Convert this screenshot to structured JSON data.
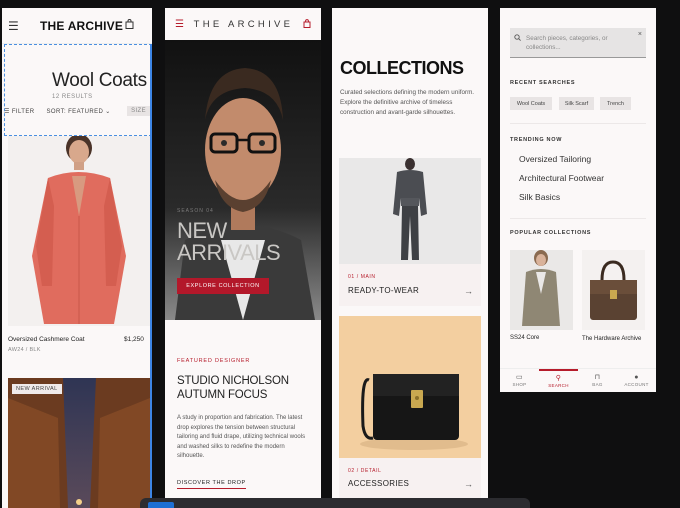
{
  "screen1": {
    "brand": "THE ARCHIVE",
    "title": "Wool Coats",
    "results": "12 RESULTS",
    "filter_label": "FILTER",
    "sort_label": "SORT: FEATURED",
    "size_label": "SIZE",
    "product": {
      "name": "Oversized Cashmere Coat",
      "meta": "AW24 / BLK",
      "price": "$1,250"
    },
    "badge": "NEW ARRIVAL"
  },
  "screen2": {
    "brand": "THE ARCHIVE",
    "season": "SEASON 04",
    "hero_title_1": "NEW",
    "hero_title_2": "ARRIVALS",
    "cta": "EXPLORE COLLECTION",
    "featured_label": "FEATURED DESIGNER",
    "designer_1": "STUDIO NICHOLSON",
    "designer_2": "AUTUMN FOCUS",
    "description": "A study in proportion and fabrication. The latest drop explores the tension between structural tailoring and fluid drape, utilizing technical wools and washed silks to redefine the modern silhouette.",
    "link": "DISCOVER THE DROP"
  },
  "screen3": {
    "title": "COLLECTIONS",
    "description": "Curated selections defining the modern uniform. Explore the definitive archive of timeless construction and avant-garde silhouettes.",
    "cards": [
      {
        "num": "01 / MAIN",
        "name": "READY-TO-WEAR"
      },
      {
        "num": "02 / DETAIL",
        "name": "ACCESSORIES"
      }
    ]
  },
  "screen4": {
    "search_placeholder": "Search pieces, categories, or collections...",
    "recent_heading": "RECENT SEARCHES",
    "recent": [
      "Wool Coats",
      "Silk Scarf",
      "Trench"
    ],
    "trending_heading": "TRENDING NOW",
    "trending": [
      "Oversized Tailoring",
      "Architectural Footwear",
      "Silk Basics"
    ],
    "popular_heading": "POPULAR COLLECTIONS",
    "popular": [
      "SS24 Core",
      "The Hardware Archive"
    ],
    "nav": [
      "SHOP",
      "SEARCH",
      "BAG",
      "ACCOUNT"
    ]
  },
  "colors": {
    "accent": "#b3182a",
    "selection": "#3d86e6"
  }
}
